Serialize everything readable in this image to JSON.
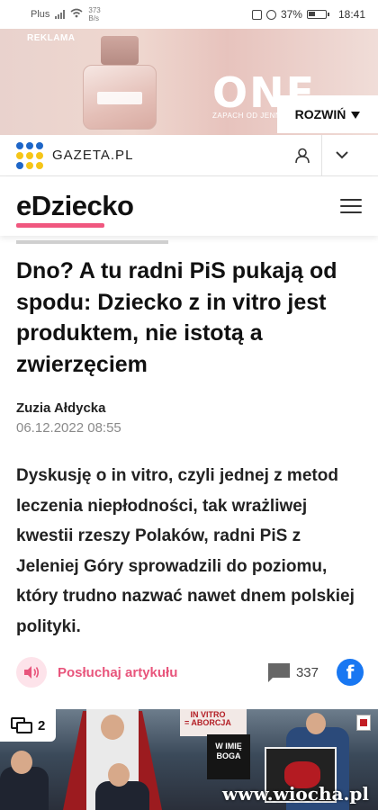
{
  "status_bar": {
    "carrier": "Plus",
    "net_speed_value": "373",
    "net_speed_unit": "B/s",
    "battery": "37%",
    "time": "18:41"
  },
  "ad": {
    "label": "REKLAMA",
    "brand": "ONE",
    "subtitle": "ZAPACH OD JENNIFE",
    "expand_label": "ROZWIŃ",
    "expand_icon": "triangle-down-icon"
  },
  "portal": {
    "name": "GAZETA.PL",
    "logo_colors": [
      "#1e66c8",
      "#1e66c8",
      "#1e66c8",
      "#f5c518",
      "#f5c518",
      "#f5c518",
      "#1e66c8",
      "#f5c518",
      "#f5c518"
    ]
  },
  "section": {
    "name": "eDziecko",
    "accent": "#f0577f"
  },
  "reading_progress": 0.44,
  "article": {
    "title": "Dno? A tu radni PiS pukają od spodu: Dziecko z in vitro jest produktem, nie istotą a zwierzęciem",
    "author": "Zuzia Ałdycka",
    "date": "06.12.2022 08:55",
    "lead": "Dyskusję o in vitro, czyli jednej z metod leczenia niepłodności, tak wrażliwej kwestii rzeszy Polaków, radni PiS z Jeleniej Góry sprowadzili do poziomu, który trudno nazwać nawet dnem polskiej polityki."
  },
  "actions": {
    "listen_label": "Posłuchaj artykułu",
    "comments_count": "337",
    "share_label": "f"
  },
  "photo": {
    "gallery_count": "2",
    "watermark": "www.wiocha.pl"
  }
}
